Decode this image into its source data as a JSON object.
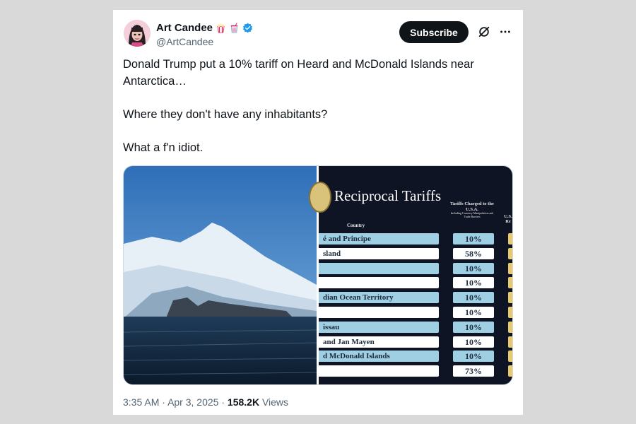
{
  "author": {
    "name": "Art Candee",
    "handle": "@ArtCandee",
    "emojis": [
      "popcorn-emoji",
      "cup-emoji"
    ],
    "verified": true
  },
  "header": {
    "subscribe_label": "Subscribe"
  },
  "tweet": {
    "paragraphs": [
      "Donald Trump put a 10% tariff on Heard and McDonald Islands near Antarctica…",
      "Where they don't have any inhabitants?",
      "What a f'n idiot."
    ]
  },
  "media": {
    "left_image": "mountain-island-photo",
    "tariff_chart": {
      "title": "Reciprocal Tariffs",
      "country_header": "Country",
      "charged_header": "Tariffs Charged to the U.S.A.",
      "charged_subheader": "Including Currency Manipulation and Trade Barriers",
      "us_header": "U.S. Re",
      "rows": [
        {
          "country": "é and Principe",
          "value": "10%",
          "style": "blue"
        },
        {
          "country": "sland",
          "value": "58%",
          "style": "white"
        },
        {
          "country": "",
          "value": "10%",
          "style": "blue"
        },
        {
          "country": "",
          "value": "10%",
          "style": "white"
        },
        {
          "country": "dian Ocean Territory",
          "value": "10%",
          "style": "blue"
        },
        {
          "country": "",
          "value": "10%",
          "style": "white"
        },
        {
          "country": "issau",
          "value": "10%",
          "style": "blue"
        },
        {
          "country": "and Jan Mayen",
          "value": "10%",
          "style": "white"
        },
        {
          "country": "d McDonald Islands",
          "value": "10%",
          "style": "blue"
        },
        {
          "country": "",
          "value": "73%",
          "style": "white"
        }
      ]
    }
  },
  "meta": {
    "time": "3:35 AM",
    "separator": "·",
    "date": "Apr 3, 2025",
    "views_count": "158.2K",
    "views_label": "Views"
  },
  "colors": {
    "verified": "#1d9bf0",
    "text": "#0f1419",
    "muted": "#536471"
  }
}
